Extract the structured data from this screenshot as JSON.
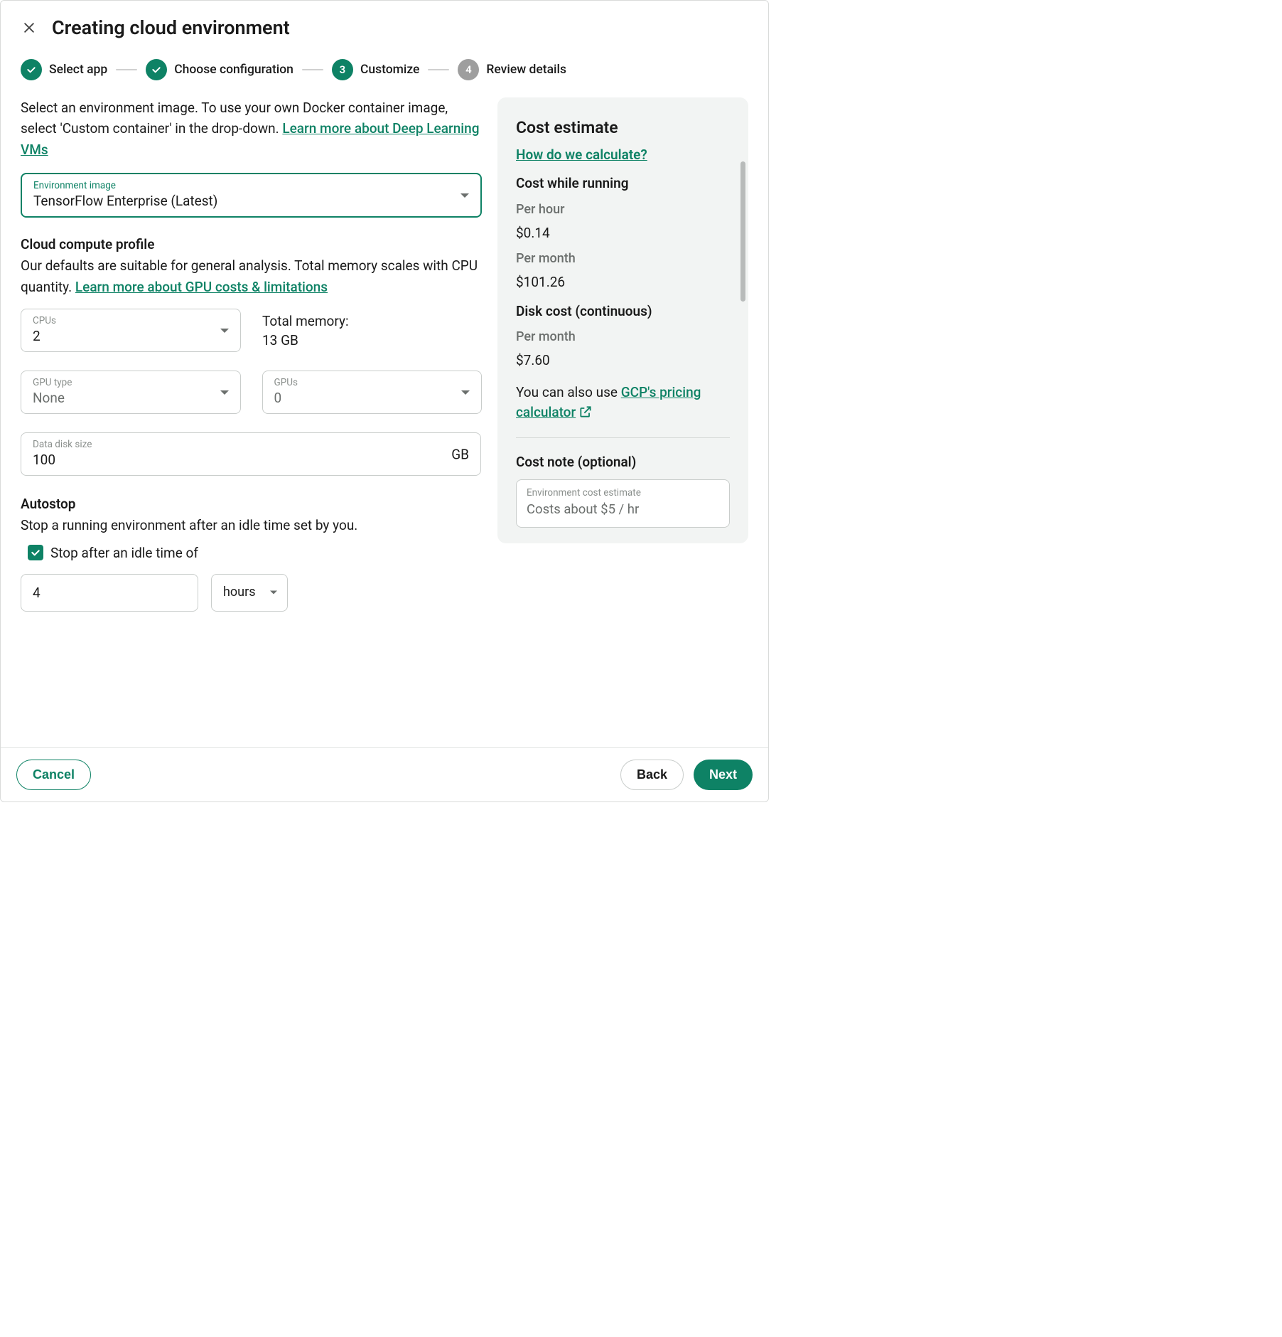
{
  "dialog": {
    "title": "Creating cloud environment"
  },
  "stepper": {
    "steps": [
      {
        "label": "Select app",
        "state": "done"
      },
      {
        "label": "Choose configuration",
        "state": "done"
      },
      {
        "label": "Customize",
        "state": "current",
        "num": "3"
      },
      {
        "label": "Review details",
        "state": "pending",
        "num": "4"
      }
    ]
  },
  "intro": {
    "text_before": "Select an environment image. To use your own Docker container image, select 'Custom container' in the drop-down. ",
    "link": "Learn more about Deep Learning VMs"
  },
  "env_image": {
    "label": "Environment image",
    "value": "TensorFlow Enterprise (Latest)"
  },
  "compute": {
    "title": "Cloud compute profile",
    "desc_before": "Our defaults are suitable for general analysis. Total memory scales with CPU quantity. ",
    "link": "Learn more about GPU costs & limitations",
    "cpus_label": "CPUs",
    "cpus_value": "2",
    "mem_label": "Total memory:",
    "mem_value": "13 GB",
    "gpu_type_label": "GPU type",
    "gpu_type_value": "None",
    "gpus_label": "GPUs",
    "gpus_value": "0",
    "disk_label": "Data disk size",
    "disk_value": "100",
    "disk_suffix": "GB"
  },
  "autostop": {
    "title": "Autostop",
    "desc": "Stop a running environment after an idle time set by you.",
    "checkbox_label": "Stop after an idle time of",
    "value": "4",
    "unit": "hours"
  },
  "cost": {
    "title": "Cost estimate",
    "calc_link": "How do we calculate?",
    "running_title": "Cost while running",
    "per_hour_label": "Per hour",
    "per_hour_value": "$0.14",
    "per_month_label": "Per month",
    "per_month_value": "$101.26",
    "disk_title": "Disk cost (continuous)",
    "disk_per_month_label": "Per month",
    "disk_per_month_value": "$7.60",
    "gcp_before": "You can also use ",
    "gcp_link": "GCP's pricing calculator",
    "note_title": "Cost note (optional)",
    "note_label": "Environment cost estimate",
    "note_placeholder": "Costs about $5 / hr"
  },
  "footer": {
    "cancel": "Cancel",
    "back": "Back",
    "next": "Next"
  }
}
